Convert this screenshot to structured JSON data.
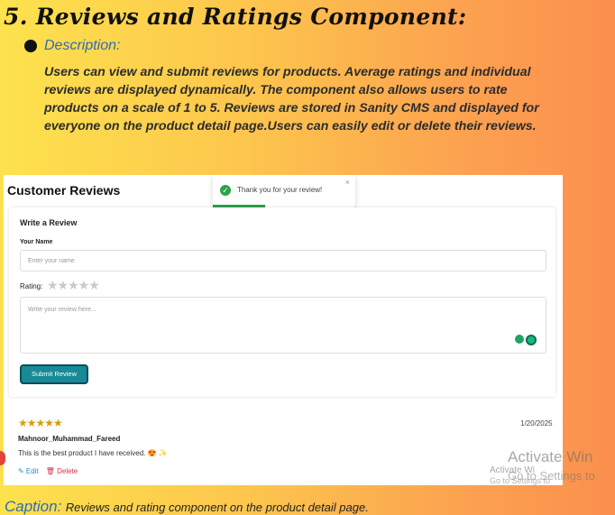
{
  "heading": "5. Reviews and Ratings Component:",
  "description": {
    "label": "Description:",
    "text": "Users can view and submit reviews for products. Average ratings and individual reviews are displayed dynamically. The component also allows users to rate products on a scale of 1 to 5. Reviews are stored in Sanity CMS and displayed for everyone on the product detail page.Users can easily edit or delete their reviews."
  },
  "screenshot": {
    "title": "Customer Reviews",
    "toast": {
      "message": "Thank you for your review!",
      "close": "×",
      "check": "✓"
    },
    "form": {
      "title": "Write a Review",
      "name_label": "Your Name",
      "name_placeholder": "Enter your name",
      "rating_label": "Rating:",
      "rating_stars": "★★★★★",
      "review_placeholder": "Write your review here...",
      "submit_label": "Submit Review"
    },
    "review": {
      "stars": "★★★★★",
      "date": "1/20/2025",
      "author": "Mahnoor_Muhammad_Fareed",
      "text": "This is the best product I have received.",
      "emoji": "😍",
      "sparkle": "✨",
      "edit_label": "✎ Edit",
      "delete_label": "🗑 Delete"
    }
  },
  "watermark": {
    "line1": "Activate Win",
    "line2": "Activate Wi",
    "line3": "Go to Settings to",
    "line4": "Go to Settings to"
  },
  "caption": {
    "label": "Caption:",
    "text": "Reviews and rating component on the product detail page."
  },
  "colors": {
    "accent_blue": "#2d6cb5",
    "submit_teal": "#178a97",
    "success_green": "#2ca24c",
    "star_gold": "#d4a00b"
  }
}
